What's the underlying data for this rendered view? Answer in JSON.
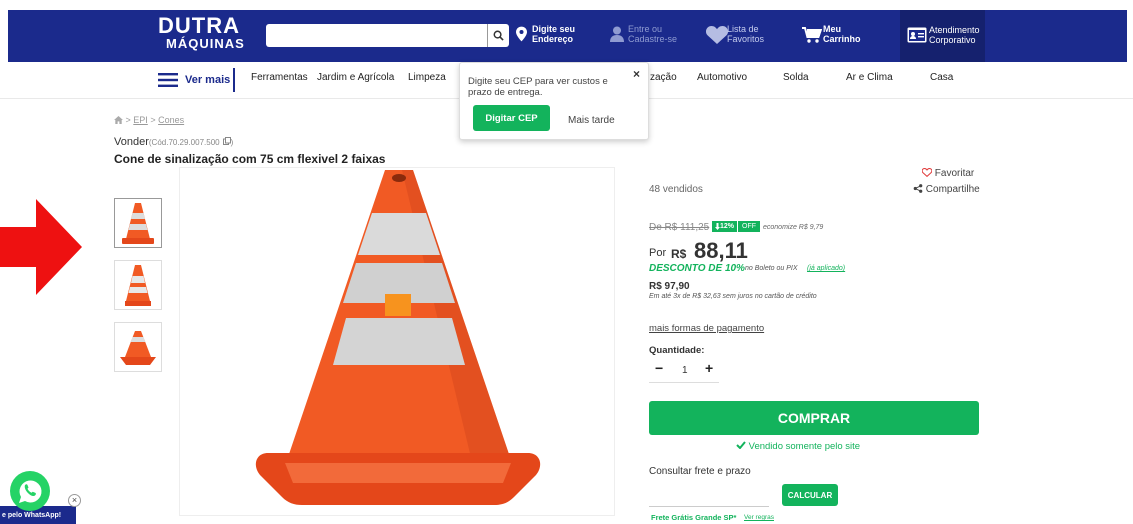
{
  "header": {
    "logo_top": "DUTRA",
    "logo_bottom": "MÁQUINAS",
    "search": {
      "value": "",
      "placeholder": ""
    },
    "address_line1": "Digite seu",
    "address_line2": "Endereço",
    "login_line1": "Entre ou",
    "login_line2": "Cadastre-se",
    "wishlist_line1": "Lista de",
    "wishlist_line2": "Favoritos",
    "cart_line1": "Meu",
    "cart_line2": "Carrinho",
    "corp_line1": "Atendimento",
    "corp_line2": "Corporativo"
  },
  "nav": {
    "menu_label": "Ver mais",
    "items": [
      "Ferramentas",
      "Jardim e Agrícola",
      "Limpeza",
      "zação",
      "Automotivo",
      "Solda",
      "Ar e Clima",
      "Casa"
    ]
  },
  "popup": {
    "text": "Digite seu CEP para ver custos e prazo de entrega.",
    "primary": "Digitar CEP",
    "secondary": "Mais tarde",
    "close": "×"
  },
  "breadcrumb": {
    "sep": ">",
    "items": [
      "EPI",
      "Cones"
    ]
  },
  "product": {
    "brand": "Vonder",
    "code": "(Cód.70.29.007.500",
    "code_end": ")",
    "title": "Cone de sinalização com 75 cm flexivel 2 faixas",
    "sold": "48 vendidos",
    "favorite": "Favoritar",
    "share": "Compartilhe"
  },
  "price": {
    "old": "De R$ 111,25",
    "discount_pct": "12%",
    "off": "OFF",
    "economy": "economize R$ 9,79",
    "por": "Por",
    "currency": "R$",
    "value": "88,11",
    "discount_text": "DESCONTO DE 10%",
    "discount_tail": "no Boleto ou PIX",
    "applied": "(já aplicado)",
    "card_price": "R$ 97,90",
    "installments": "Em até 3x de R$ 32,63 sem juros no cartão de crédito",
    "more_payment": "mais formas de pagamento"
  },
  "quantity": {
    "label": "Quantidade:",
    "value": "1",
    "minus": "−",
    "plus": "+"
  },
  "buy": {
    "label": "COMPRAR",
    "sold_by": "Vendido somente pelo site"
  },
  "shipping": {
    "label": "Consultar frete e prazo",
    "calc": "CALCULAR",
    "free": "Frete Grátis Grande SP*",
    "rules": "Ver regras"
  },
  "whatsapp": {
    "label": "e pelo WhatsApp!",
    "close": "×"
  },
  "colors": {
    "header_blue": "#1b2a8c",
    "green": "#13b35c",
    "red_arrow": "#ee1111",
    "cone_orange": "#f15a24"
  }
}
